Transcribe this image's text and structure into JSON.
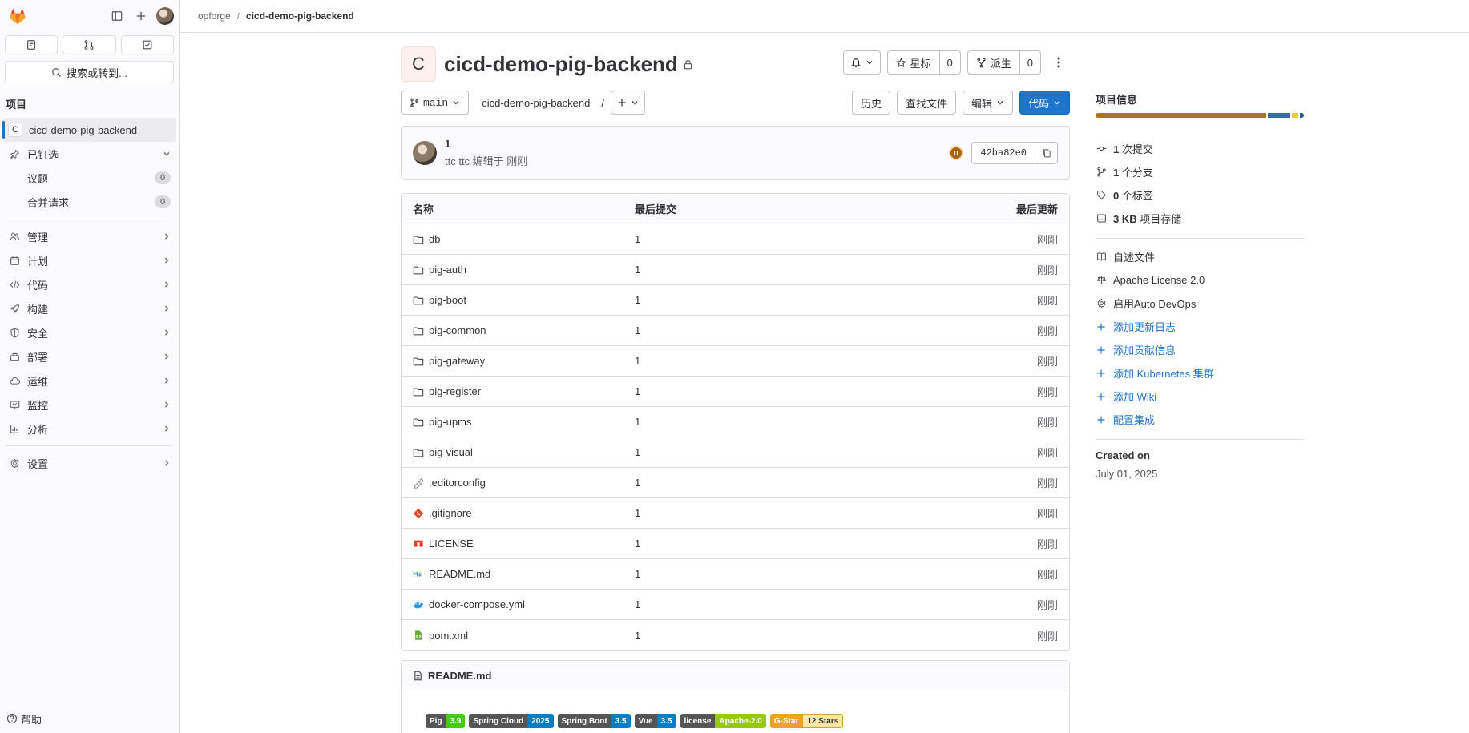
{
  "colors": {
    "accent": "#1f75cb",
    "brand": "#fc6d26"
  },
  "sidebar": {
    "search_label": "搜索或转到...",
    "section": "项目",
    "project_letter": "C",
    "project_name": "cicd-demo-pig-backend",
    "pinned_label": "已钉选",
    "pinned_items": [
      {
        "label": "议题",
        "count": "0"
      },
      {
        "label": "合并请求",
        "count": "0"
      }
    ],
    "nav": [
      {
        "label": "管理",
        "icon": "users-icon"
      },
      {
        "label": "计划",
        "icon": "calendar-icon"
      },
      {
        "label": "代码",
        "icon": "code-icon"
      },
      {
        "label": "构建",
        "icon": "rocket-icon"
      },
      {
        "label": "安全",
        "icon": "shield-icon"
      },
      {
        "label": "部署",
        "icon": "deploy-icon"
      },
      {
        "label": "运维",
        "icon": "cloud-icon"
      },
      {
        "label": "监控",
        "icon": "monitor-icon"
      },
      {
        "label": "分析",
        "icon": "chart-icon"
      }
    ],
    "settings_label": "设置",
    "help_label": "帮助"
  },
  "breadcrumb": {
    "group": "opforge",
    "project": "cicd-demo-pig-backend"
  },
  "project": {
    "letter": "C",
    "title": "cicd-demo-pig-backend",
    "star_label": "星标",
    "star_count": "0",
    "fork_label": "派生",
    "fork_count": "0"
  },
  "controls": {
    "branch": "main",
    "path": "cicd-demo-pig-backend",
    "path_sep": "/",
    "history": "历史",
    "find_file": "查找文件",
    "edit": "编辑",
    "code": "代码"
  },
  "commit": {
    "message": "1",
    "meta": "ttc ttc 编辑于 刚刚",
    "sha": "42ba82e0"
  },
  "tree": {
    "headers": {
      "name": "名称",
      "last_commit": "最后提交",
      "last_update": "最后更新"
    },
    "rows": [
      {
        "name": "db",
        "type": "folder",
        "commit": "1",
        "updated": "刚刚"
      },
      {
        "name": "pig-auth",
        "type": "folder",
        "commit": "1",
        "updated": "刚刚"
      },
      {
        "name": "pig-boot",
        "type": "folder",
        "commit": "1",
        "updated": "刚刚"
      },
      {
        "name": "pig-common",
        "type": "folder",
        "commit": "1",
        "updated": "刚刚"
      },
      {
        "name": "pig-gateway",
        "type": "folder",
        "commit": "1",
        "updated": "刚刚"
      },
      {
        "name": "pig-register",
        "type": "folder",
        "commit": "1",
        "updated": "刚刚"
      },
      {
        "name": "pig-upms",
        "type": "folder",
        "commit": "1",
        "updated": "刚刚"
      },
      {
        "name": "pig-visual",
        "type": "folder",
        "commit": "1",
        "updated": "刚刚"
      },
      {
        "name": ".editorconfig",
        "type": "editorconfig",
        "commit": "1",
        "updated": "刚刚"
      },
      {
        "name": ".gitignore",
        "type": "git",
        "commit": "1",
        "updated": "刚刚"
      },
      {
        "name": "LICENSE",
        "type": "license",
        "commit": "1",
        "updated": "刚刚"
      },
      {
        "name": "README.md",
        "type": "markdown",
        "commit": "1",
        "updated": "刚刚"
      },
      {
        "name": "docker-compose.yml",
        "type": "docker",
        "commit": "1",
        "updated": "刚刚"
      },
      {
        "name": "pom.xml",
        "type": "xml",
        "commit": "1",
        "updated": "刚刚"
      }
    ]
  },
  "readme": {
    "title": "README.md",
    "badges": [
      {
        "label": "Pig",
        "value": "3.9",
        "color": "#4c1"
      },
      {
        "label": "Spring Cloud",
        "value": "2025",
        "color": "#007ec6"
      },
      {
        "label": "Spring Boot",
        "value": "3.5",
        "color": "#007ec6"
      },
      {
        "label": "Vue",
        "value": "3.5",
        "color": "#007ec6"
      },
      {
        "label": "license",
        "value": "Apache-2.0",
        "color": "#97ca00"
      },
      {
        "label": "G-Star",
        "value": "12 Stars",
        "color": "#fde5a8"
      }
    ]
  },
  "info": {
    "title": "项目信息",
    "languages": [
      {
        "share": 82,
        "color": "#a8761f"
      },
      {
        "share": 11,
        "color": "#3a6e9a"
      },
      {
        "share": 3,
        "color": "#f1c84b"
      },
      {
        "share": 2,
        "color": "#2b5a7c"
      }
    ],
    "stats": [
      {
        "count": "1",
        "label": "次提交",
        "icon": "commit-icon"
      },
      {
        "count": "1",
        "label": "个分支",
        "icon": "branch-icon"
      },
      {
        "count": "0",
        "label": "个标签",
        "icon": "tag-icon"
      },
      {
        "count": "3 KB",
        "label": "项目存储",
        "icon": "storage-icon"
      }
    ],
    "files": [
      {
        "label": "自述文件",
        "icon": "book-icon"
      },
      {
        "label": "Apache License 2.0",
        "icon": "scale-icon"
      },
      {
        "label": "启用Auto DevOps",
        "icon": "gear-icon"
      }
    ],
    "add_links": [
      "添加更新日志",
      "添加贡献信息",
      "添加 Kubernetes 集群",
      "添加 Wiki",
      "配置集成"
    ],
    "created_label": "Created on",
    "created_date": "July 01, 2025"
  }
}
